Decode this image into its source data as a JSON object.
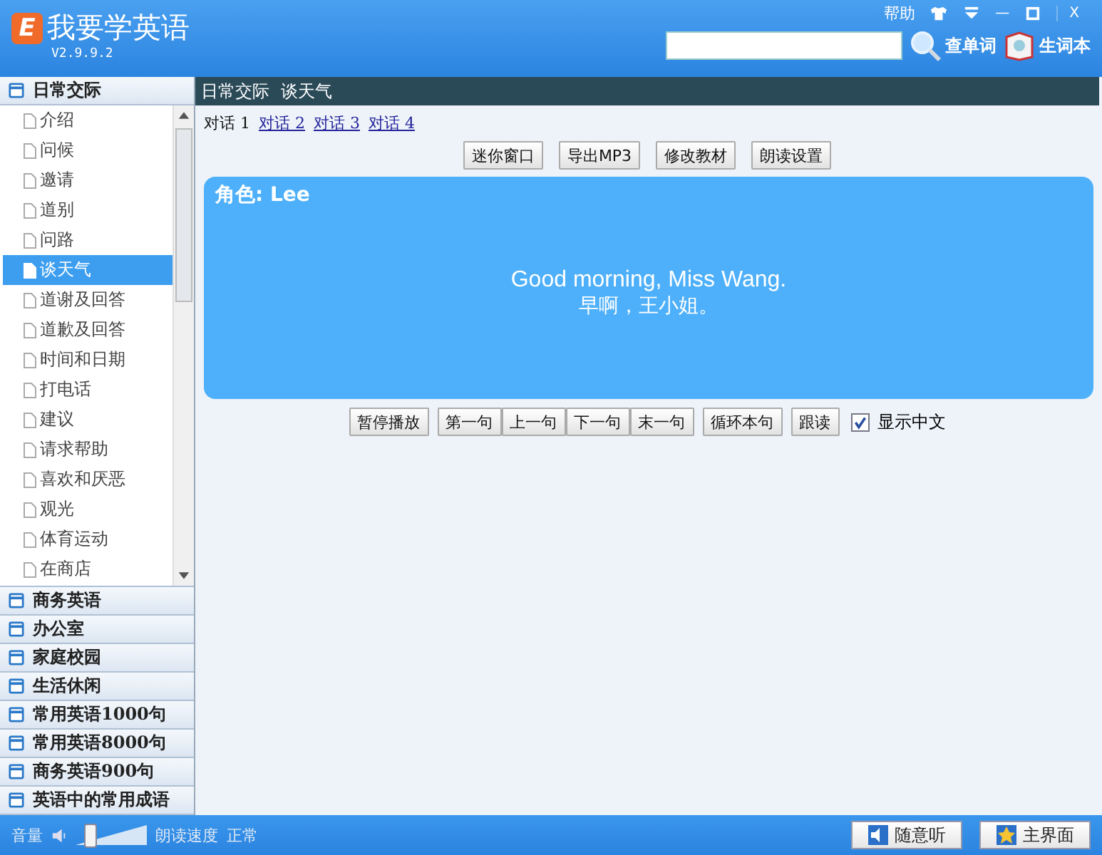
{
  "header": {
    "logo_letter": "E",
    "app_name": "我要学英语",
    "version": "V2.9.9.2",
    "help": "帮助",
    "minimize": "—",
    "close": "X",
    "lookup_button": "查单词",
    "vocab_button": "生词本"
  },
  "sidebar": {
    "categories": [
      {
        "label": "日常交际",
        "items": [
          {
            "label": "介绍",
            "selected": false
          },
          {
            "label": "问候",
            "selected": false
          },
          {
            "label": "邀请",
            "selected": false
          },
          {
            "label": "道别",
            "selected": false
          },
          {
            "label": "问路",
            "selected": false
          },
          {
            "label": "谈天气",
            "selected": true
          },
          {
            "label": "道谢及回答",
            "selected": false
          },
          {
            "label": "道歉及回答",
            "selected": false
          },
          {
            "label": "时间和日期",
            "selected": false
          },
          {
            "label": "打电话",
            "selected": false
          },
          {
            "label": "建议",
            "selected": false
          },
          {
            "label": "请求帮助",
            "selected": false
          },
          {
            "label": "喜欢和厌恶",
            "selected": false
          },
          {
            "label": "观光",
            "selected": false
          },
          {
            "label": "体育运动",
            "selected": false
          },
          {
            "label": "在商店",
            "selected": false
          }
        ]
      },
      {
        "label": "商务英语"
      },
      {
        "label": "办公室"
      },
      {
        "label": "家庭校园"
      },
      {
        "label": "生活休闲"
      },
      {
        "label": "常用英语1000句"
      },
      {
        "label": "常用英语8000句"
      },
      {
        "label": "商务英语900句"
      },
      {
        "label": "英语中的常用成语"
      }
    ]
  },
  "content": {
    "breadcrumb": "日常交际  谈天气",
    "dialogues": [
      {
        "label": "对话 1",
        "selected": true
      },
      {
        "label": "对话 2",
        "selected": false
      },
      {
        "label": "对话 3",
        "selected": false
      },
      {
        "label": "对话 4",
        "selected": false
      }
    ],
    "tool_buttons": [
      "迷你窗口",
      "导出MP3",
      "修改教材",
      "朗读设置"
    ],
    "role": "角色: Lee",
    "english": "Good morning, Miss Wang.",
    "chinese": "早啊，王小姐。",
    "play_button": "暂停播放",
    "nav_buttons": [
      "第一句",
      "上一句",
      "下一句",
      "末一句"
    ],
    "loop_button": "循环本句",
    "follow_button": "跟读",
    "show_chinese": {
      "label": "显示中文",
      "checked": true
    }
  },
  "status_bar": {
    "volume_label": "音量",
    "volume": {
      "level": 0.2
    },
    "speed_label": "朗读速度",
    "speed": "正常",
    "random_button": "随意听",
    "home_button": "主界面"
  }
}
